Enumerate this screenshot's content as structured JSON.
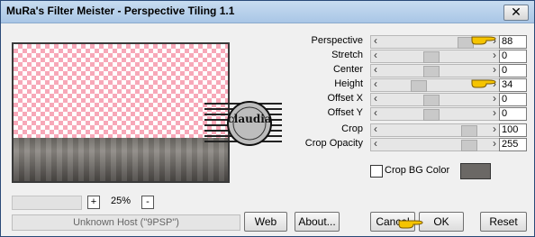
{
  "window": {
    "title": "MuRa's Filter Meister - Perspective Tiling 1.1",
    "close_glyph": "✕"
  },
  "zoom": {
    "minus": "-",
    "plus": "+",
    "value": "25%"
  },
  "host": {
    "text": "Unknown Host (\"9PSP\")"
  },
  "watermark": {
    "text": "claudia"
  },
  "params": [
    {
      "label": "Perspective",
      "value": "88"
    },
    {
      "label": "Stretch",
      "value": "0"
    },
    {
      "label": "Center",
      "value": "0"
    },
    {
      "label": "Height",
      "value": "34"
    },
    {
      "label": "Offset X",
      "value": "0"
    },
    {
      "label": "Offset Y",
      "value": "0"
    },
    {
      "label": "Crop",
      "value": "100"
    },
    {
      "label": "Crop Opacity",
      "value": "255"
    }
  ],
  "crop_bg": {
    "label": "Crop BG Color",
    "color": "#6b6865"
  },
  "buttons": {
    "web": "Web",
    "about": "About...",
    "cancel": "Cancel",
    "ok": "OK",
    "reset": "Reset"
  },
  "colors": {
    "title_bar": "#b8d2ee",
    "pointer": "#f5c400",
    "checker_pink": "#f7a8b8"
  }
}
